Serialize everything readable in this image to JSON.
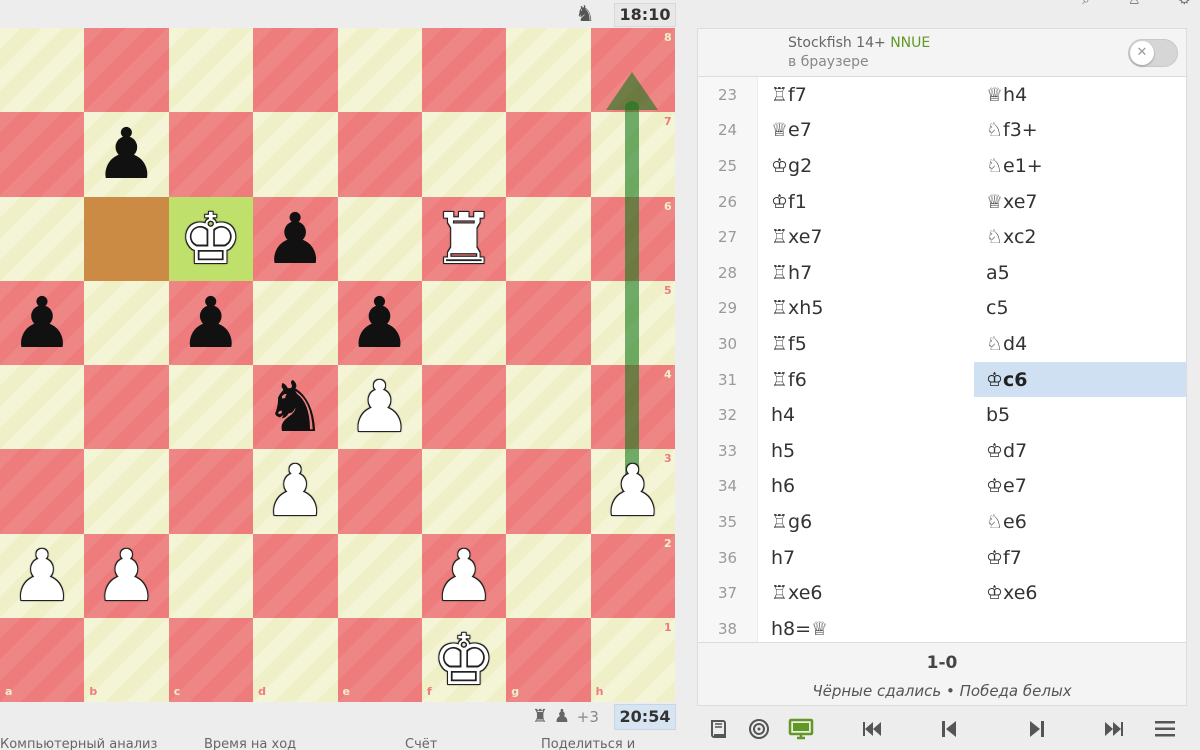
{
  "clocks": {
    "opponent": "18:10",
    "player": "20:54"
  },
  "material": {
    "pieces": "♜ ♟",
    "diff": "+3"
  },
  "engine": {
    "name": "Stockfish 14+",
    "tag": "NNUE",
    "location": "в браузере",
    "toggle_icon": "✕"
  },
  "moves": [
    {
      "n": "23",
      "w": "♖f7",
      "b": "♕h4"
    },
    {
      "n": "24",
      "w": "♕e7",
      "b": "♘f3+"
    },
    {
      "n": "25",
      "w": "♔g2",
      "b": "♘e1+"
    },
    {
      "n": "26",
      "w": "♔f1",
      "b": "♕xe7"
    },
    {
      "n": "27",
      "w": "♖xe7",
      "b": "♘xc2"
    },
    {
      "n": "28",
      "w": "♖h7",
      "b": "a5"
    },
    {
      "n": "29",
      "w": "♖xh5",
      "b": "c5"
    },
    {
      "n": "30",
      "w": "♖f5",
      "b": "♘d4"
    },
    {
      "n": "31",
      "w": "♖f6",
      "b": "♔c6"
    },
    {
      "n": "32",
      "w": "h4",
      "b": "b5"
    },
    {
      "n": "33",
      "w": "h5",
      "b": "♔d7"
    },
    {
      "n": "34",
      "w": "h6",
      "b": "♔e7"
    },
    {
      "n": "35",
      "w": "♖g6",
      "b": "♘e6"
    },
    {
      "n": "36",
      "w": "h7",
      "b": "♔f7"
    },
    {
      "n": "37",
      "w": "♖xe6",
      "b": "♔xe6"
    },
    {
      "n": "38",
      "w": "h8=♕",
      "b": ""
    }
  ],
  "active_move": "31b",
  "result": {
    "score": "1-0",
    "status": "Чёрные сдались • Победа белых"
  },
  "bottom_tabs": [
    "Компьютерный анализ",
    "Время на ход",
    "Счёт",
    "Поделиться и"
  ],
  "board": {
    "files": [
      "a",
      "b",
      "c",
      "d",
      "e",
      "f",
      "g",
      "h"
    ],
    "ranks": [
      "8",
      "7",
      "6",
      "5",
      "4",
      "3",
      "2",
      "1"
    ],
    "pieces": [
      {
        "sq": "b7",
        "p": "♟",
        "c": "b"
      },
      {
        "sq": "c6",
        "p": "♚",
        "c": "w"
      },
      {
        "sq": "d6",
        "p": "♟",
        "c": "b"
      },
      {
        "sq": "f6",
        "p": "♜",
        "c": "w"
      },
      {
        "sq": "a5",
        "p": "♟",
        "c": "b"
      },
      {
        "sq": "c5",
        "p": "♟",
        "c": "b"
      },
      {
        "sq": "e5",
        "p": "♟",
        "c": "b"
      },
      {
        "sq": "d4",
        "p": "♞",
        "c": "b"
      },
      {
        "sq": "e4",
        "p": "♟",
        "c": "w"
      },
      {
        "sq": "d3",
        "p": "♟",
        "c": "w"
      },
      {
        "sq": "h3",
        "p": "♟",
        "c": "w"
      },
      {
        "sq": "a2",
        "p": "♟",
        "c": "w"
      },
      {
        "sq": "b2",
        "p": "♟",
        "c": "w"
      },
      {
        "sq": "f2",
        "p": "♟",
        "c": "w"
      },
      {
        "sq": "f1",
        "p": "♚",
        "c": "w"
      }
    ],
    "last_move_square": "b6",
    "king_highlight_square": "c6",
    "arrow": {
      "from": "h3",
      "to": "h8",
      "color": "#15781B"
    }
  },
  "controls": [
    "book-icon",
    "target-icon",
    "computer-icon",
    "first-icon",
    "prev-icon",
    "next-icon",
    "last-icon",
    "menu-icon"
  ],
  "colors": {
    "light_square": "#f0f0c8",
    "dark_square": "#ee7c7c",
    "last_move": "#cc8b45",
    "king_highlight": "#bfe06a",
    "active_move": "#cfe0f2",
    "accent_green": "#629924"
  }
}
